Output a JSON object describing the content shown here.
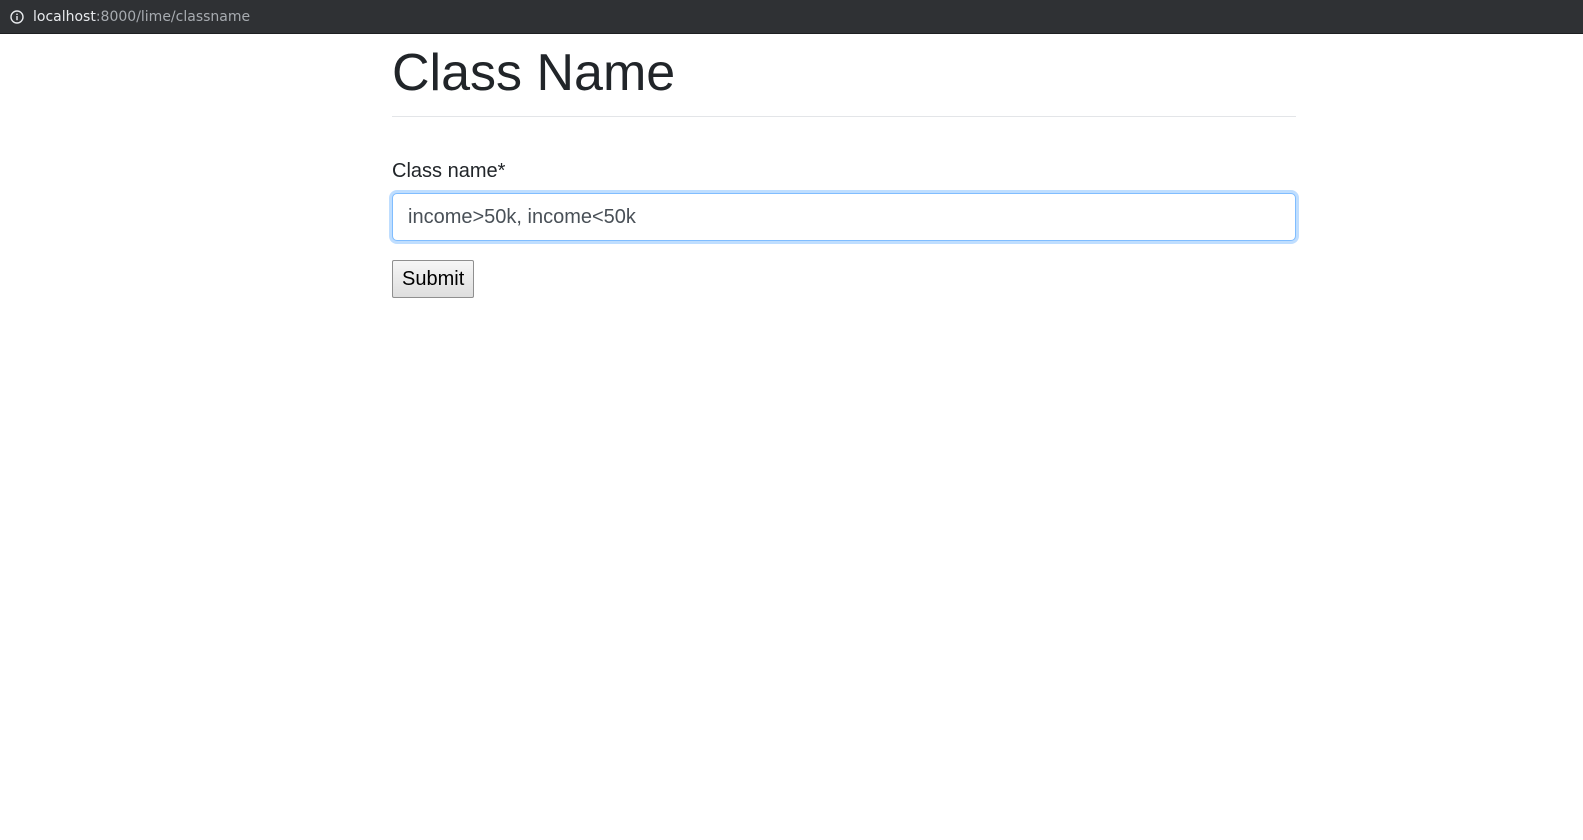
{
  "browser": {
    "url_host": "localhost",
    "url_path": ":8000/lime/classname",
    "info_icon": "info-icon"
  },
  "page": {
    "title": "Class Name"
  },
  "form": {
    "label": "Class name*",
    "input_value": "income>50k, income<50k",
    "submit_label": "Submit"
  },
  "colors": {
    "browser_bar": "#2f3134",
    "focus_border": "#80bdff",
    "text": "#212529"
  }
}
